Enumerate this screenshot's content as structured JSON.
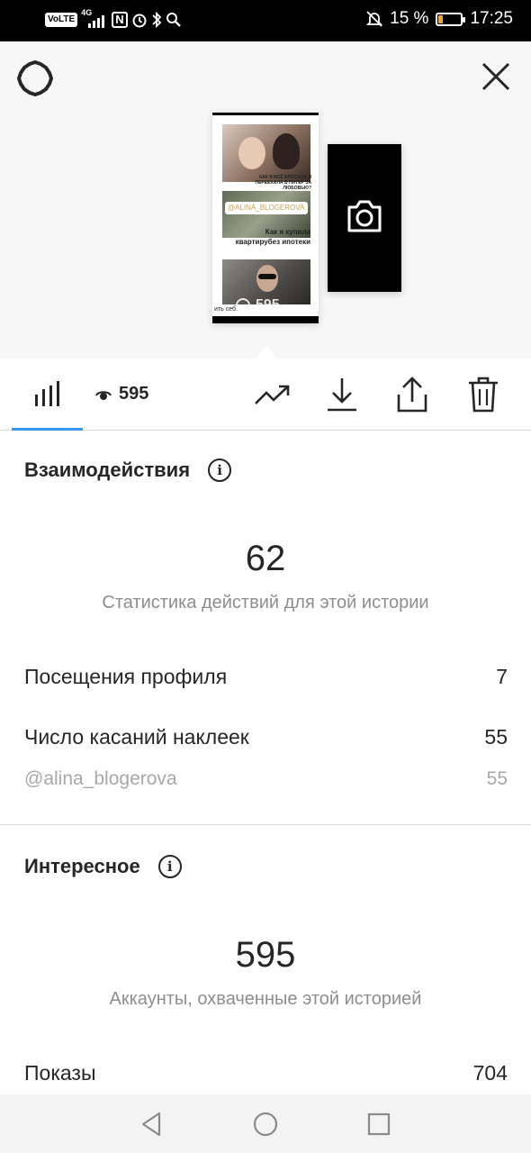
{
  "status_bar": {
    "volte": "VoLTE",
    "network": "4G",
    "nfc": "N",
    "battery_percent": "15 %",
    "time": "17:25",
    "battery_level": 15
  },
  "story_preview": {
    "caption_1": "КАК Я ВСЁ БРОСИЛА И ПЕРЕЕХАЛА В ПИТЕР ЗА ЛЮБОВЬЮ?",
    "handle_tag": "@ALINA_BLOGEROVA",
    "caption_2": "Как я купила квартирубез ипотеки",
    "caption_3": "ить себ...",
    "views": "595"
  },
  "toolbar": {
    "views_count": "595"
  },
  "interactions": {
    "title": "Взаимодействия",
    "info": "i",
    "total": "62",
    "caption": "Статистика действий для этой истории",
    "rows": [
      {
        "label": "Посещения профиля",
        "value": "7"
      },
      {
        "label": "Число касаний наклеек",
        "value": "55"
      }
    ],
    "sub_row": {
      "label": "@alina_blogerova",
      "value": "55"
    }
  },
  "discovery": {
    "title": "Интересное",
    "info": "i",
    "total": "595",
    "caption": "Аккаунты, охваченные этой историей",
    "rows": [
      {
        "label": "Показы",
        "value": "704"
      }
    ]
  },
  "colors": {
    "accent": "#3897f0",
    "text": "#262626",
    "muted": "#8e8e8e",
    "battery": "#f5a623"
  },
  "icons": [
    "settings-icon",
    "close-icon",
    "camera-icon",
    "bar-chart-icon",
    "eye-icon",
    "trending-icon",
    "download-icon",
    "share-icon",
    "trash-icon",
    "back-nav-icon",
    "home-nav-icon",
    "recents-nav-icon"
  ]
}
